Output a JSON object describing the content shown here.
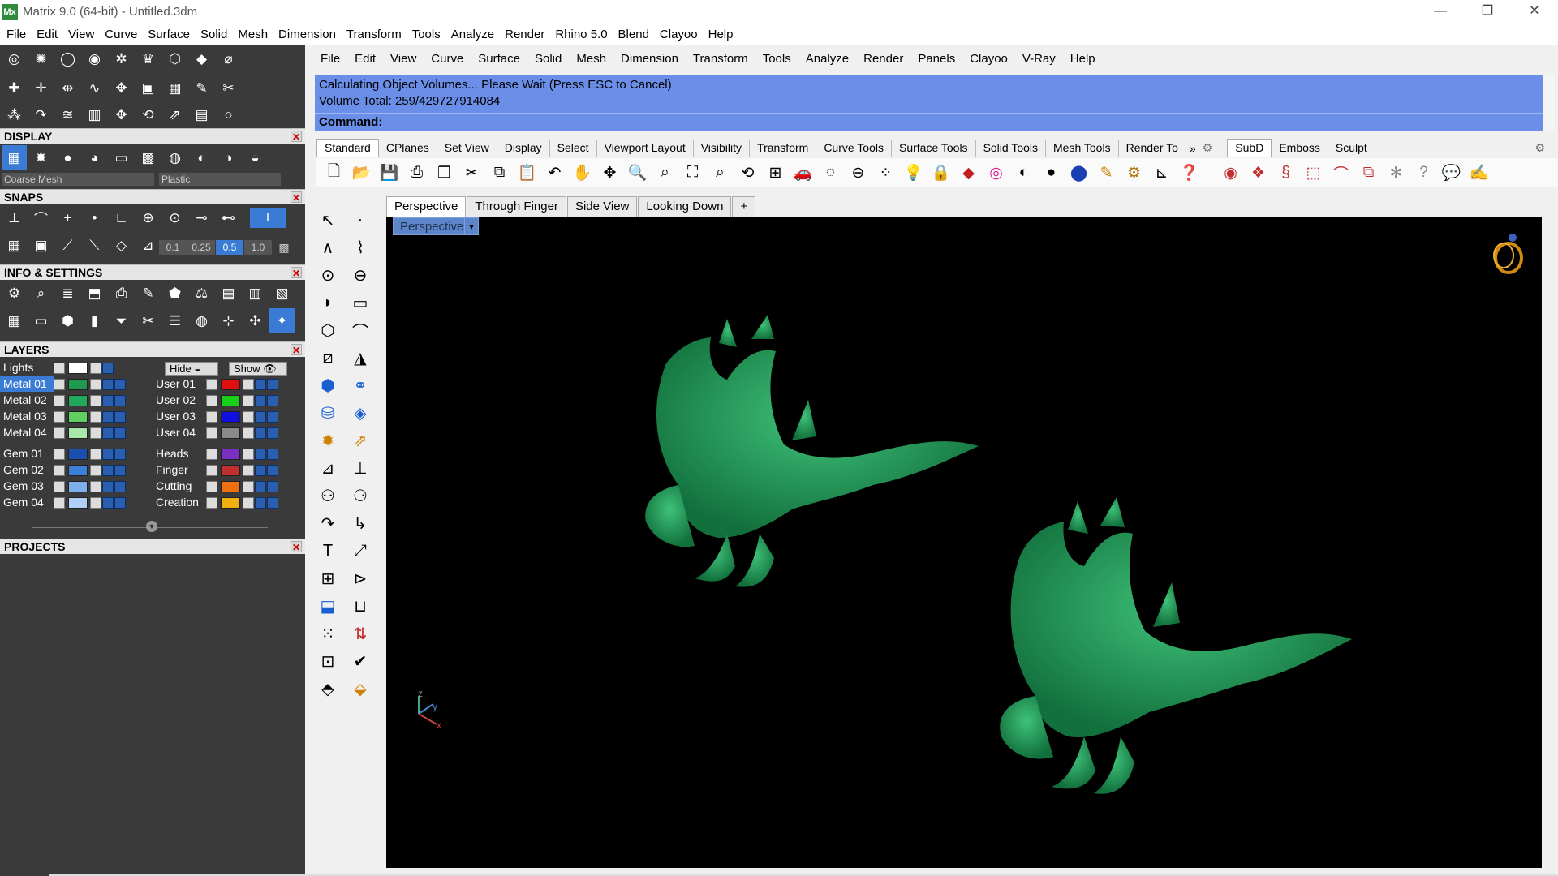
{
  "window": {
    "title": "Matrix 9.0 (64-bit) - Untitled.3dm",
    "app_icon": "Mx",
    "controls": [
      "—",
      "❐",
      "✕"
    ]
  },
  "outer_menu": [
    "File",
    "Edit",
    "View",
    "Curve",
    "Surface",
    "Solid",
    "Mesh",
    "Dimension",
    "Transform",
    "Tools",
    "Analyze",
    "Render",
    "Rhino 5.0",
    "Blend",
    "Clayoo",
    "Help"
  ],
  "panel": {
    "display": {
      "title": "DISPLAY",
      "mesh_select": "Coarse Mesh",
      "material_select": "Plastic"
    },
    "snaps": {
      "title": "SNAPS",
      "values": [
        "0.1",
        "0.25",
        "0.5",
        "1.0"
      ]
    },
    "info": {
      "title": "INFO & SETTINGS"
    },
    "layers": {
      "title": "LAYERS",
      "lights_label": "Lights",
      "hide_label": "Hide",
      "show_label": "Show",
      "left": [
        {
          "name": "Metal 01",
          "color": "#1f9a4e",
          "selected": true
        },
        {
          "name": "Metal 02",
          "color": "#22a85a",
          "selected": false
        },
        {
          "name": "Metal 03",
          "color": "#5fd05f",
          "selected": false
        },
        {
          "name": "Metal 04",
          "color": "#a8e8a8",
          "selected": false
        },
        {
          "name": "Gem 01",
          "color": "#1a4fb0",
          "selected": false
        },
        {
          "name": "Gem 02",
          "color": "#3b7fd8",
          "selected": false
        },
        {
          "name": "Gem 03",
          "color": "#7fb0ee",
          "selected": false
        },
        {
          "name": "Gem 04",
          "color": "#b0d0f5",
          "selected": false
        }
      ],
      "right": [
        {
          "name": "User 01",
          "color": "#e01010"
        },
        {
          "name": "User 02",
          "color": "#18d018"
        },
        {
          "name": "User 03",
          "color": "#1010e0"
        },
        {
          "name": "User 04",
          "color": "#8a8a8a"
        },
        {
          "name": "Heads",
          "color": "#7b2fc0"
        },
        {
          "name": "Finger",
          "color": "#c03030"
        },
        {
          "name": "Cutting",
          "color": "#f07010"
        },
        {
          "name": "Creation",
          "color": "#f0b010"
        }
      ]
    },
    "projects": {
      "title": "PROJECTS"
    }
  },
  "inner_menu": [
    "File",
    "Edit",
    "View",
    "Curve",
    "Surface",
    "Solid",
    "Mesh",
    "Dimension",
    "Transform",
    "Tools",
    "Analyze",
    "Render",
    "Panels",
    "Clayoo",
    "V-Ray",
    "Help"
  ],
  "command": {
    "line1": "Calculating Object Volumes... Please Wait (Press ESC to Cancel)",
    "line2": "Volume Total: 259/429727914084",
    "prompt": "Command:"
  },
  "toolbar_tabs": [
    "Standard",
    "CPlanes",
    "Set View",
    "Display",
    "Select",
    "Viewport Layout",
    "Visibility",
    "Transform",
    "Curve Tools",
    "Surface Tools",
    "Solid Tools",
    "Mesh Tools",
    "Render To"
  ],
  "toolbar_tabs_overflow": "»",
  "toolbar_tabs_right": [
    "SubD",
    "Emboss",
    "Sculpt"
  ],
  "viewport": {
    "tabs": [
      "Perspective",
      "Through Finger",
      "Side View",
      "Looking Down"
    ],
    "add_tab": "+",
    "label": "Perspective",
    "dropdown": "▾",
    "axis_x": "x",
    "axis_y": "y",
    "axis_z": "z"
  },
  "colors": {
    "model_green": "#1f9a55",
    "command_bg": "#6b8fe8",
    "panel_dark": "#3a3a3a",
    "selection": "#3a7bd5"
  }
}
